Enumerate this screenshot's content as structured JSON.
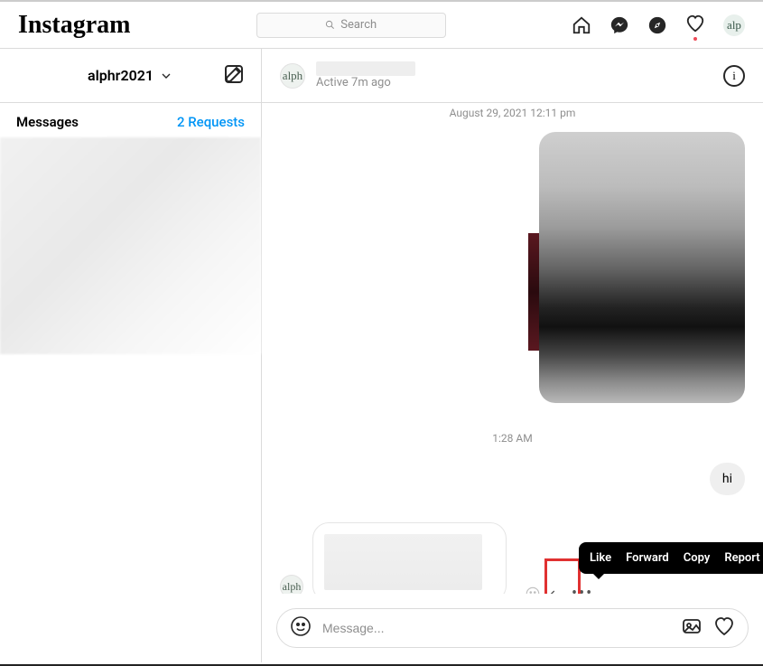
{
  "nav": {
    "logo": "Instagram",
    "search_placeholder": "Search",
    "avatar_text": "alp"
  },
  "sidebar": {
    "username": "alphr2021",
    "inbox_title": "Messages",
    "requests_label": "2 Requests"
  },
  "chat": {
    "header": {
      "avatar_text": "alph",
      "status": "Active 7m ago"
    },
    "date_separator": "August 29, 2021 12:11 pm",
    "time_separator": "1:28 AM",
    "sent_text_1": "hi",
    "received_avatar_text": "alph",
    "action_menu": {
      "like": "Like",
      "forward": "Forward",
      "copy": "Copy",
      "report": "Report"
    }
  },
  "composer": {
    "placeholder": "Message..."
  }
}
